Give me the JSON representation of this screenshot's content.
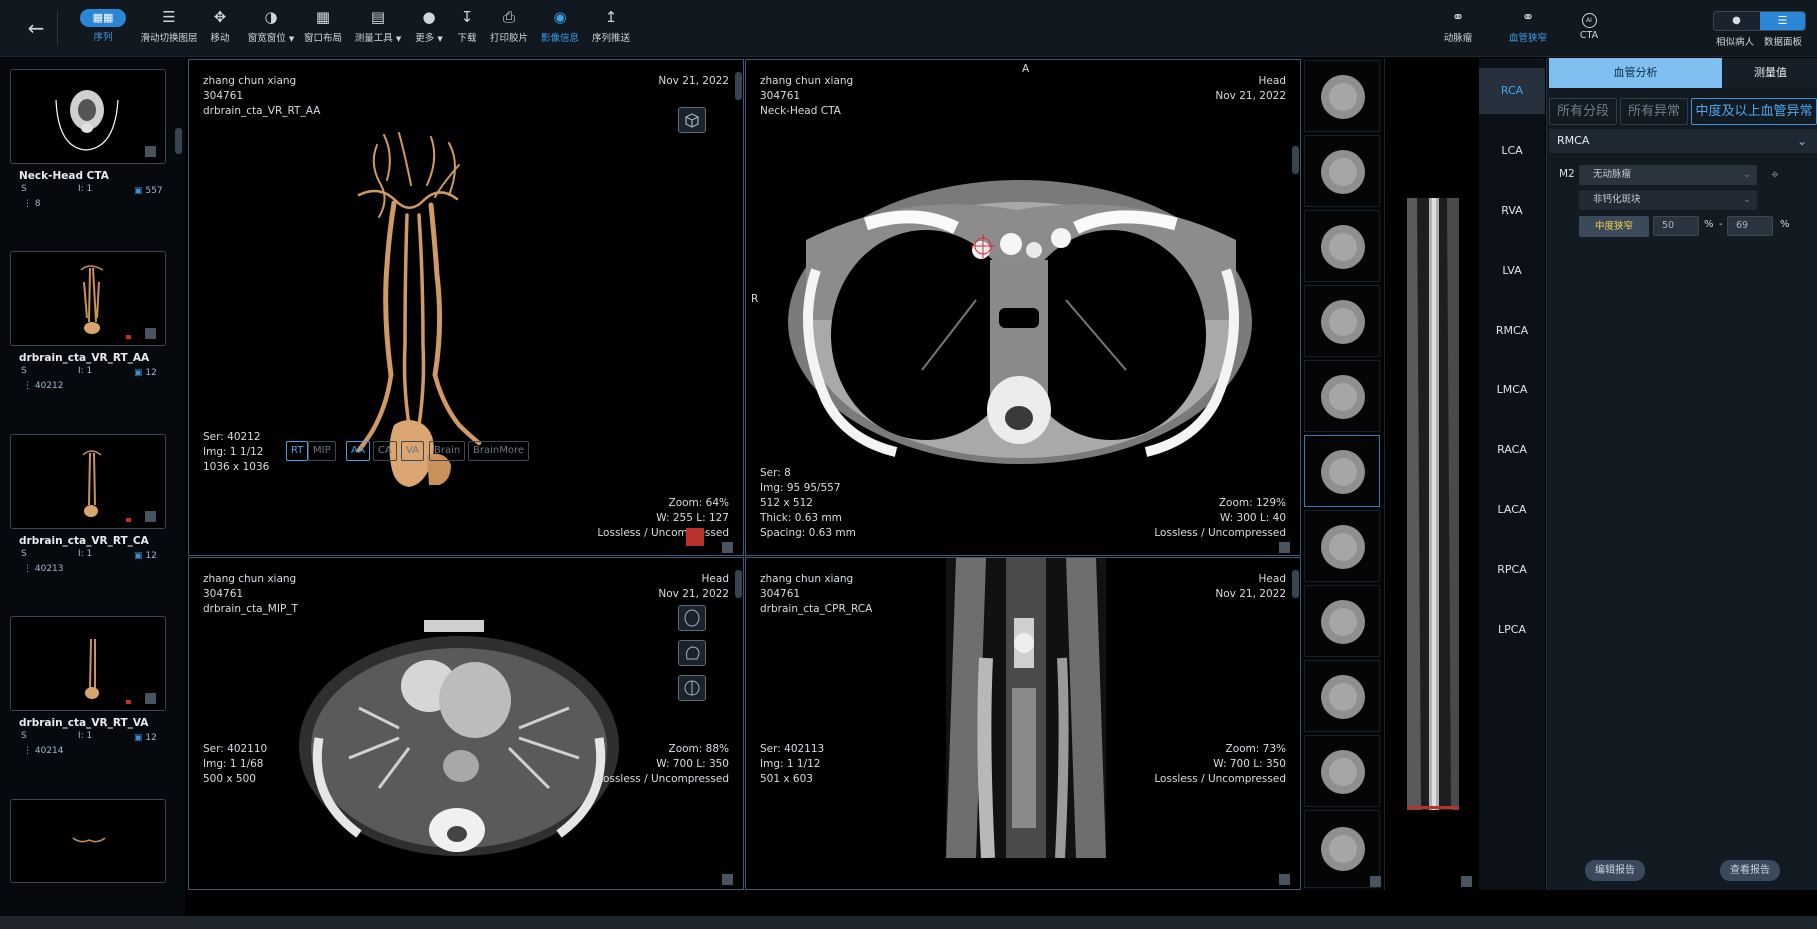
{
  "toolbar": {
    "items": [
      {
        "label": "序列",
        "icon": "grid-icon"
      },
      {
        "label": "滑动切换图层",
        "icon": "layers-icon"
      },
      {
        "label": "移动",
        "icon": "move-icon"
      },
      {
        "label": "窗宽窗位",
        "icon": "contrast-icon"
      },
      {
        "label": "窗口布局",
        "icon": "layout-grid-icon"
      },
      {
        "label": "测量工具",
        "icon": "ruler-icon"
      },
      {
        "label": "更多",
        "icon": "more-icon"
      },
      {
        "label": "下载",
        "icon": "download-icon"
      },
      {
        "label": "打印胶片",
        "icon": "print-icon"
      },
      {
        "label": "影像信息",
        "icon": "eye-icon"
      },
      {
        "label": "序列推送",
        "icon": "upload-icon"
      }
    ],
    "right_items": [
      {
        "label": "动脉瘤",
        "icon": "aneurysm-icon"
      },
      {
        "label": "血管狭窄",
        "icon": "stenosis-icon"
      },
      {
        "label": "CTA",
        "icon": "cta-icon",
        "badge": "AI"
      }
    ],
    "mode_labels": [
      "相似病人",
      "数据面板"
    ]
  },
  "sidebar": {
    "series": [
      {
        "name": "Neck-Head CTA",
        "s": "S",
        "i": "I: 1",
        "count": "557",
        "num": "8"
      },
      {
        "name": "drbrain_cta_VR_RT_AA",
        "s": "S",
        "i": "I: 1",
        "count": "12",
        "num": "40212"
      },
      {
        "name": "drbrain_cta_VR_RT_CA",
        "s": "S",
        "i": "I: 1",
        "count": "12",
        "num": "40213"
      },
      {
        "name": "drbrain_cta_VR_RT_VA",
        "s": "S",
        "i": "I: 1",
        "count": "12",
        "num": "40214"
      }
    ]
  },
  "viewports": {
    "vr": {
      "patient": "zhang chun xiang",
      "id": "304761",
      "series_name": "drbrain_cta_VR_RT_AA",
      "date": "Nov 21, 2022",
      "ser": "Ser: 40212",
      "img": "Img: 1 1/12",
      "size": "1036 x 1036",
      "zoom": "Zoom: 64%",
      "wl": "W: 255 L: 127",
      "compression": "Lossless / Uncompressed",
      "modes": [
        "RT",
        "MIP",
        "AA",
        "CA",
        "VA",
        "Brain",
        "BrainMore"
      ]
    },
    "axial": {
      "patient": "zhang chun xiang",
      "id": "304761",
      "series_name": "Neck-Head CTA",
      "region": "Head",
      "date": "Nov 21, 2022",
      "orient_top": "A",
      "orient_left": "R",
      "ser": "Ser: 8",
      "img": "Img: 95 95/557",
      "size": "512 x 512",
      "thick": "Thick: 0.63 mm",
      "spacing": "Spacing: 0.63 mm",
      "zoom": "Zoom: 129%",
      "wl": "W: 300 L: 40",
      "compression": "Lossless / Uncompressed"
    },
    "mip": {
      "patient": "zhang chun xiang",
      "id": "304761",
      "series_name": "drbrain_cta_MIP_T",
      "region": "Head",
      "date": "Nov 21, 2022",
      "ser": "Ser: 402110",
      "img": "Img: 1 1/68",
      "size": "500 x 500",
      "zoom": "Zoom: 88%",
      "wl": "W: 700 L: 350",
      "compression": "Lossless / Uncompressed"
    },
    "cpr": {
      "patient": "zhang chun xiang",
      "id": "304761",
      "series_name": "drbrain_cta_CPR_RCA",
      "region": "Head",
      "date": "Nov 21, 2022",
      "ser": "Ser: 402113",
      "img": "Img: 1 1/12",
      "size": "501 x 603",
      "zoom": "Zoom: 73%",
      "wl": "W: 700 L: 350",
      "compression": "Lossless / Uncompressed"
    }
  },
  "vessels": [
    "RCA",
    "LCA",
    "RVA",
    "LVA",
    "RMCA",
    "LMCA",
    "RACA",
    "LACA",
    "RPCA",
    "LPCA"
  ],
  "selected_vessel": "RCA",
  "panel": {
    "tabs": [
      "血管分析",
      "测量值"
    ],
    "filters": [
      "所有分段",
      "所有异常",
      "中度及以上血管异常"
    ],
    "section": "RMCA",
    "segment": "M2",
    "select1": "无动脉瘤",
    "select2": "非钙化斑块",
    "stenosis_label": "中度狭窄",
    "range_min": "50",
    "range_max": "69",
    "percent": "%",
    "dash": "-",
    "buttons": [
      "编辑报告",
      "查看报告"
    ]
  }
}
